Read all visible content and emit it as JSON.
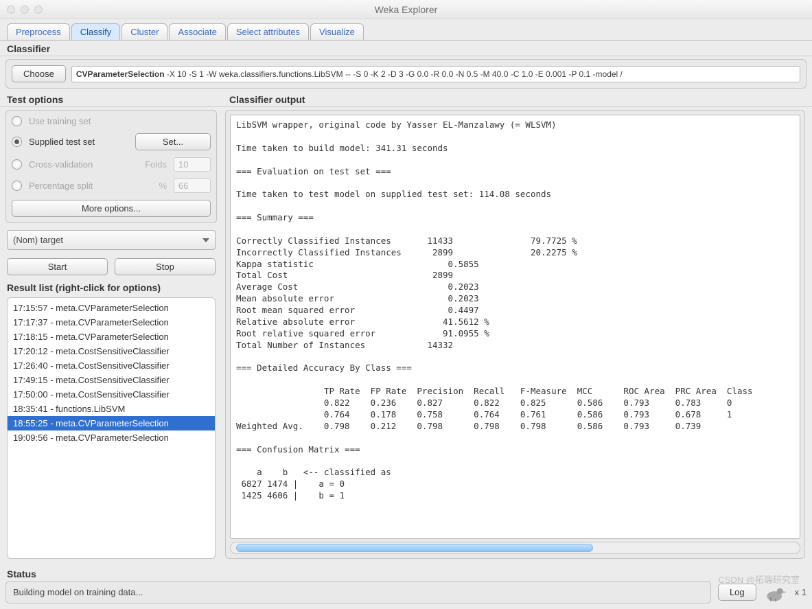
{
  "window": {
    "title": "Weka Explorer"
  },
  "tabs": {
    "items": [
      "Preprocess",
      "Classify",
      "Cluster",
      "Associate",
      "Select attributes",
      "Visualize"
    ],
    "active": 1
  },
  "classifier_section": {
    "title": "Classifier",
    "choose_label": "Choose",
    "algo_name": "CVParameterSelection",
    "algo_args": " -X 10 -S 1 -W weka.classifiers.functions.LibSVM -- -S 0 -K 2 -D 3 -G 0.0 -R 0.0 -N 0.5 -M 40.0 -C 1.0 -E 0.001 -P 0.1 -model /"
  },
  "test_options": {
    "title": "Test options",
    "use_training": "Use training set",
    "supplied": "Supplied test set",
    "set_btn": "Set...",
    "cross_val": "Cross-validation",
    "folds_label": "Folds",
    "folds_value": "10",
    "pct_split": "Percentage split",
    "pct_label": "%",
    "pct_value": "66",
    "more_options": "More options...",
    "selected": "supplied"
  },
  "target_attr": {
    "label": "(Nom) target"
  },
  "buttons": {
    "start": "Start",
    "stop": "Stop"
  },
  "result_list": {
    "title": "Result list (right-click for options)",
    "items": [
      "17:15:57 - meta.CVParameterSelection",
      "17:17:37 - meta.CVParameterSelection",
      "17:18:15 - meta.CVParameterSelection",
      "17:20:12 - meta.CostSensitiveClassifier",
      "17:26:40 - meta.CostSensitiveClassifier",
      "17:49:15 - meta.CostSensitiveClassifier",
      "17:50:00 - meta.CostSensitiveClassifier",
      "18:35:41 - functions.LibSVM",
      "18:55:25 - meta.CVParameterSelection",
      "19:09:56 - meta.CVParameterSelection"
    ],
    "selected": 8
  },
  "classifier_output": {
    "title": "Classifier output",
    "text": "LibSVM wrapper, original code by Yasser EL-Manzalawy (= WLSVM)\n\nTime taken to build model: 341.31 seconds\n\n=== Evaluation on test set ===\n\nTime taken to test model on supplied test set: 114.08 seconds\n\n=== Summary ===\n\nCorrectly Classified Instances       11433               79.7725 %\nIncorrectly Classified Instances      2899               20.2275 %\nKappa statistic                          0.5855\nTotal Cost                            2899\nAverage Cost                             0.2023\nMean absolute error                      0.2023\nRoot mean squared error                  0.4497\nRelative absolute error                 41.5612 %\nRoot relative squared error             91.0955 %\nTotal Number of Instances            14332\n\n=== Detailed Accuracy By Class ===\n\n                 TP Rate  FP Rate  Precision  Recall   F-Measure  MCC      ROC Area  PRC Area  Class\n                 0.822    0.236    0.827      0.822    0.825      0.586    0.793     0.783     0\n                 0.764    0.178    0.758      0.764    0.761      0.586    0.793     0.678     1\nWeighted Avg.    0.798    0.212    0.798      0.798    0.798      0.586    0.793     0.739\n\n=== Confusion Matrix ===\n\n    a    b   <-- classified as\n 6827 1474 |    a = 0\n 1425 4606 |    b = 1\n"
  },
  "status": {
    "title": "Status",
    "text": "Building model on training data...",
    "log_label": "Log",
    "x1": "x 1"
  },
  "watermark": "CSDN @拓端研究室"
}
